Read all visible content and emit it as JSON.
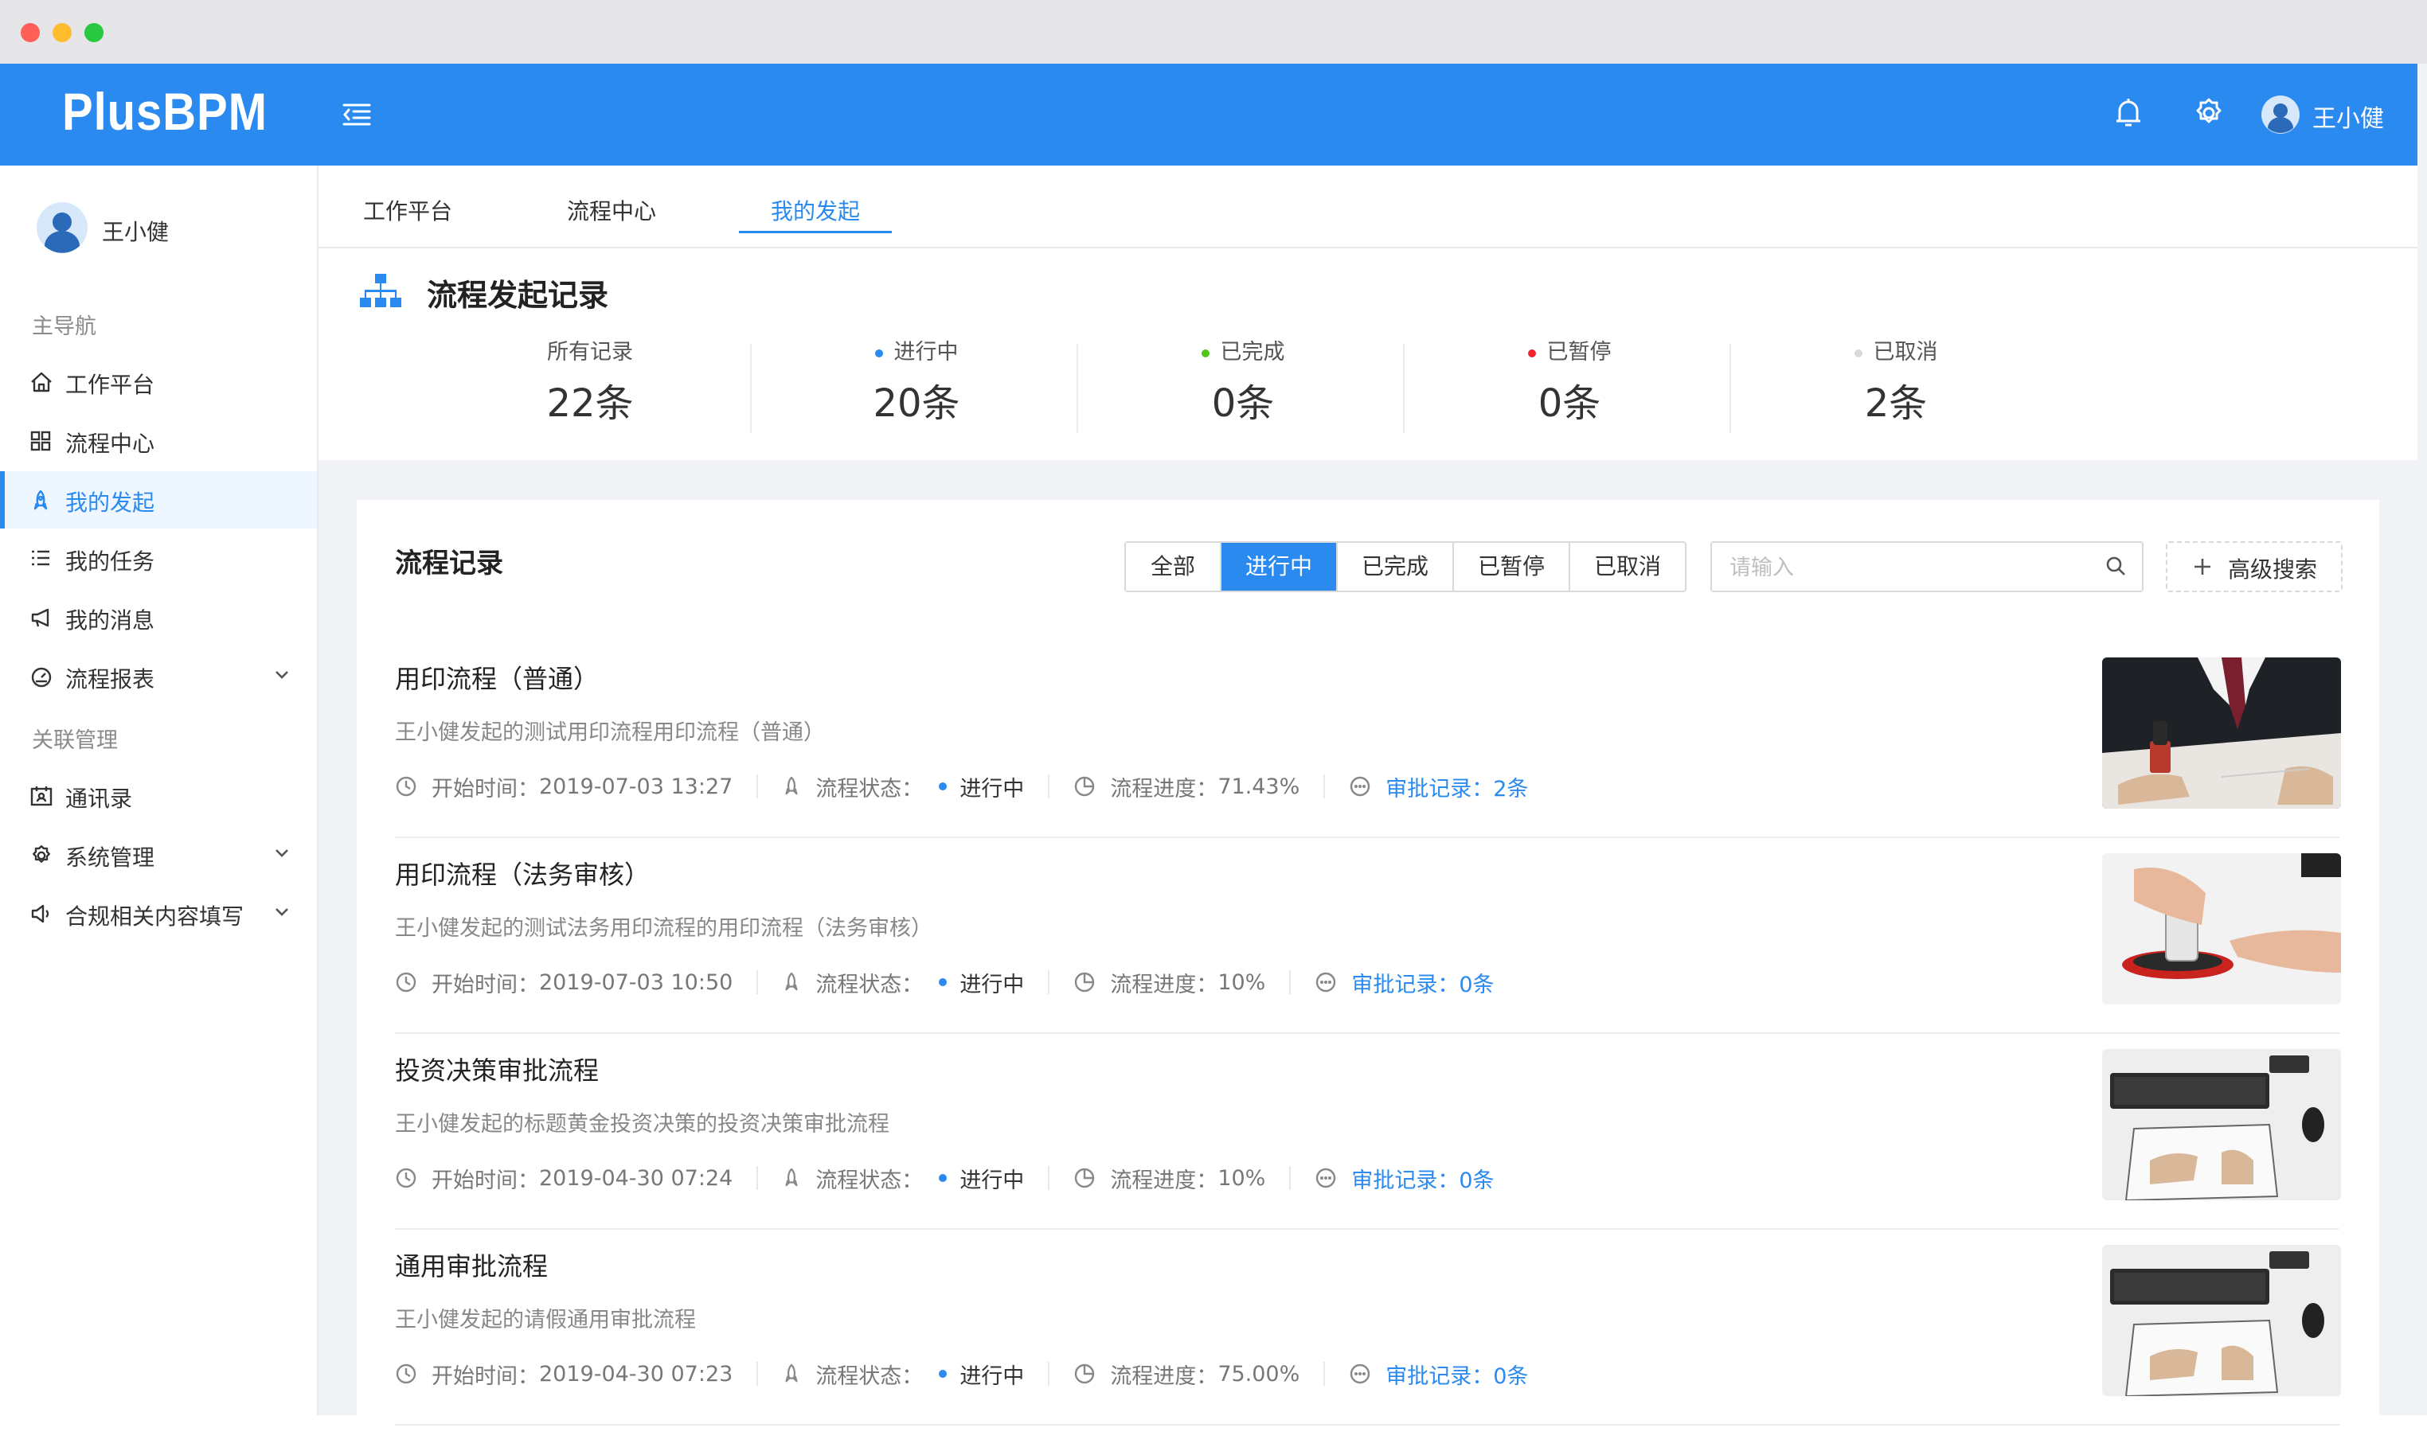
{
  "header": {
    "logo": "PlusBPM",
    "user_name": "王小健",
    "icons": [
      "menu-fold-icon",
      "bell-icon",
      "gear-icon",
      "user-avatar-icon"
    ]
  },
  "sidebar": {
    "user_name": "王小健",
    "groups": {
      "main": "主导航",
      "related": "关联管理"
    },
    "items": [
      {
        "label": "工作平台",
        "icon": "home-icon"
      },
      {
        "label": "流程中心",
        "icon": "grid-icon"
      },
      {
        "label": "我的发起",
        "icon": "rocket-icon",
        "active": true
      },
      {
        "label": "我的任务",
        "icon": "list-icon"
      },
      {
        "label": "我的消息",
        "icon": "megaphone-icon"
      },
      {
        "label": "流程报表",
        "icon": "dashboard-icon",
        "expandable": true
      },
      {
        "label": "通讯录",
        "icon": "contacts-icon"
      },
      {
        "label": "系统管理",
        "icon": "gear-icon",
        "expandable": true
      },
      {
        "label": "合规相关内容填写",
        "icon": "sound-icon",
        "expandable": true
      }
    ]
  },
  "tabs": [
    {
      "label": "工作平台"
    },
    {
      "label": "流程中心"
    },
    {
      "label": "我的发起",
      "active": true
    }
  ],
  "summary": {
    "title": "流程发起记录",
    "stats": [
      {
        "label": "所有记录",
        "value": "22条",
        "dot_color": ""
      },
      {
        "label": "进行中",
        "value": "20条",
        "dot_color": "#2a8af0"
      },
      {
        "label": "已完成",
        "value": "0条",
        "dot_color": "#52c41a"
      },
      {
        "label": "已暂停",
        "value": "0条",
        "dot_color": "#f5222d"
      },
      {
        "label": "已取消",
        "value": "2条",
        "dot_color": "#d9d9d9"
      }
    ]
  },
  "records": {
    "title": "流程记录",
    "filters": [
      {
        "label": "全部"
      },
      {
        "label": "进行中",
        "active": true
      },
      {
        "label": "已完成"
      },
      {
        "label": "已暂停"
      },
      {
        "label": "已取消"
      }
    ],
    "search_placeholder": "请输入",
    "advanced_search_label": "高级搜索",
    "field_labels": {
      "start_time": "开始时间：",
      "status": "流程状态：",
      "progress": "流程进度：",
      "approval": "审批记录："
    },
    "items": [
      {
        "title": "用印流程（普通）",
        "desc": "王小健发起的测试用印流程用印流程（普通）",
        "start_time": "2019-07-03 13:27",
        "status": "进行中",
        "progress": "71.43%",
        "approval_count": "2条"
      },
      {
        "title": "用印流程（法务审核）",
        "desc": "王小健发起的测试法务用印流程的用印流程（法务审核）",
        "start_time": "2019-07-03 10:50",
        "status": "进行中",
        "progress": "10%",
        "approval_count": "0条"
      },
      {
        "title": "投资决策审批流程",
        "desc": "王小健发起的标题黄金投资决策的投资决策审批流程",
        "start_time": "2019-04-30 07:24",
        "status": "进行中",
        "progress": "10%",
        "approval_count": "0条"
      },
      {
        "title": "通用审批流程",
        "desc": "王小健发起的请假通用审批流程",
        "start_time": "2019-04-30 07:23",
        "status": "进行中",
        "progress": "75.00%",
        "approval_count": "0条"
      }
    ]
  },
  "colors": {
    "primary": "#2a8af0",
    "success": "#52c41a",
    "danger": "#f5222d",
    "muted": "#d9d9d9"
  }
}
